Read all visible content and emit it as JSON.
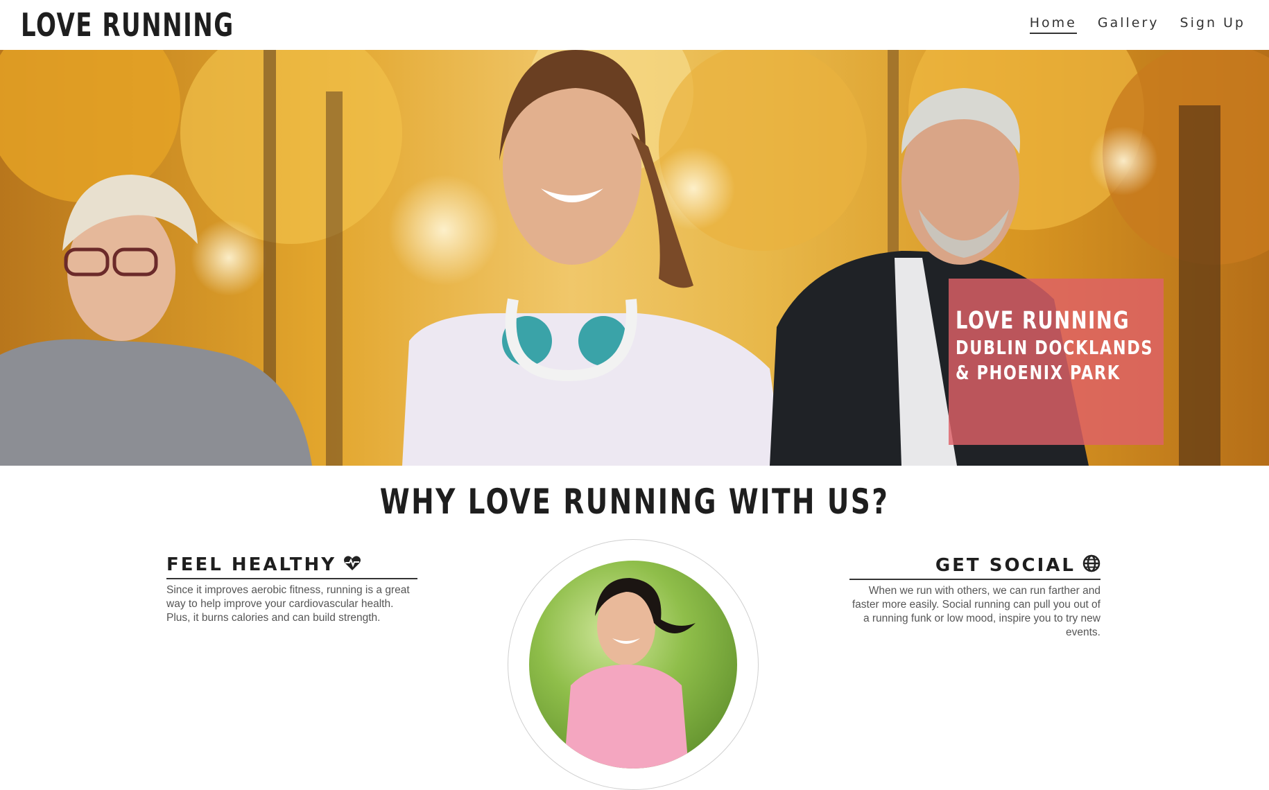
{
  "header": {
    "brand": "LOVE RUNNING",
    "nav": [
      {
        "label": "Home",
        "active": true
      },
      {
        "label": "Gallery",
        "active": false
      },
      {
        "label": "Sign Up",
        "active": false
      }
    ]
  },
  "hero": {
    "card_line1": "LOVE RUNNING",
    "card_line2": "DUBLIN DOCKLANDS & PHOENIX PARK"
  },
  "section": {
    "title": "WHY LOVE RUNNING WITH US?",
    "features": [
      {
        "title": "FEEL HEALTHY",
        "icon": "heartbeat-icon",
        "text": "Since it improves aerobic fitness, running is a great way to help improve your cardiovascular health. Plus, it burns calories and can build strength."
      },
      {
        "title": "GET SOCIAL",
        "icon": "globe-icon",
        "text": "When we run with others, we can run farther and faster more easily. Social running can pull you out of a running funk or low mood, inspire you to try new events."
      }
    ]
  },
  "colors": {
    "card_bg": "#de6068",
    "text_dark": "#1e1e1e"
  }
}
